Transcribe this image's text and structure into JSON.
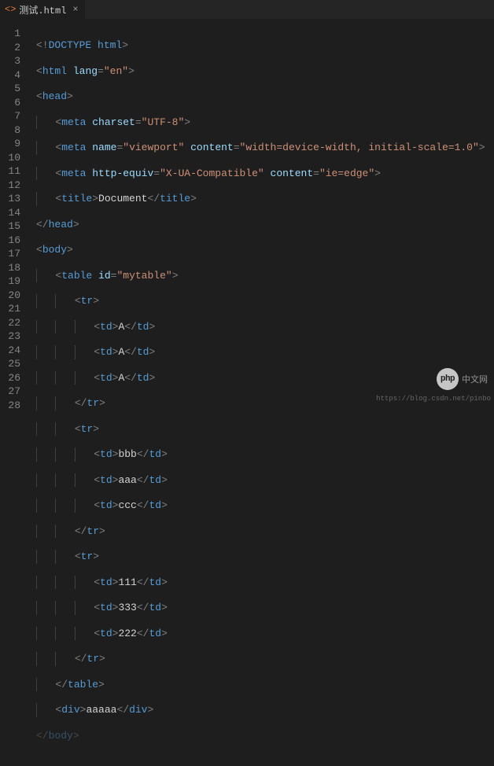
{
  "tab": {
    "filename": "测试.html",
    "close_glyph": "×",
    "icon": "<>"
  },
  "lines": [
    1,
    2,
    3,
    4,
    5,
    6,
    7,
    8,
    9,
    10,
    11,
    12,
    13,
    14,
    15,
    16,
    17,
    18,
    19,
    20,
    21,
    22,
    23,
    24,
    25,
    26,
    27,
    28
  ],
  "code": {
    "l1": {
      "doctype_open": "<!",
      "doctype": "DOCTYPE",
      "space": " ",
      "html": "html",
      "close": ">"
    },
    "l2": {
      "open": "<",
      "tag": "html",
      "attr1": "lang",
      "eq": "=",
      "val1": "\"en\"",
      "close": ">"
    },
    "l3": {
      "open": "<",
      "tag": "head",
      "close": ">"
    },
    "l4": {
      "open": "<",
      "tag": "meta",
      "attr1": "charset",
      "eq": "=",
      "val1": "\"UTF-8\"",
      "close": ">"
    },
    "l5": {
      "open": "<",
      "tag": "meta",
      "attr1": "name",
      "eq": "=",
      "val1": "\"viewport\"",
      "attr2": "content",
      "val2": "\"width=device-width, initial-scale=1.0\"",
      "close": ">"
    },
    "l6": {
      "open": "<",
      "tag": "meta",
      "attr1": "http-equiv",
      "eq": "=",
      "val1": "\"X-UA-Compatible\"",
      "attr2": "content",
      "val2": "\"ie=edge\"",
      "close": ">"
    },
    "l7": {
      "open": "<",
      "tag": "title",
      "close": ">",
      "text": "Document",
      "open2": "</",
      "tag2": "title",
      "close2": ">"
    },
    "l8": {
      "open": "</",
      "tag": "head",
      "close": ">"
    },
    "l9": {
      "open": "<",
      "tag": "body",
      "close": ">"
    },
    "l10": {
      "open": "<",
      "tag": "table",
      "attr1": "id",
      "eq": "=",
      "val1": "\"mytable\"",
      "close": ">"
    },
    "l11": {
      "open": "<",
      "tag": "tr",
      "close": ">"
    },
    "td": {
      "open": "<",
      "tag": "td",
      "close": ">",
      "open2": "</",
      "close2": ">"
    },
    "l12_text": "A",
    "l13_text": "A",
    "l14_text": "A",
    "l15": {
      "open": "</",
      "tag": "tr",
      "close": ">"
    },
    "l16": {
      "open": "<",
      "tag": "tr",
      "close": ">"
    },
    "l17_text": "bbb",
    "l18_text": "aaa",
    "l19_text": "ccc",
    "l20": {
      "open": "</",
      "tag": "tr",
      "close": ">"
    },
    "l21": {
      "open": "<",
      "tag": "tr",
      "close": ">"
    },
    "l22_text": "111",
    "l23_text": "333",
    "l24_text": "222",
    "l25": {
      "open": "</",
      "tag": "tr",
      "close": ">"
    },
    "l26": {
      "open": "</",
      "tag": "table",
      "close": ">"
    },
    "l27": {
      "open": "<",
      "tag": "div",
      "close": ">",
      "text": "aaaaa",
      "open2": "</",
      "tag2": "div",
      "close2": ">"
    },
    "l28": {
      "open": "</",
      "tag": "body",
      "close": ">"
    }
  },
  "watermark": {
    "badge": "php",
    "text": "中文网"
  },
  "footer_link": "https://blog.csdn.net/pinbo"
}
